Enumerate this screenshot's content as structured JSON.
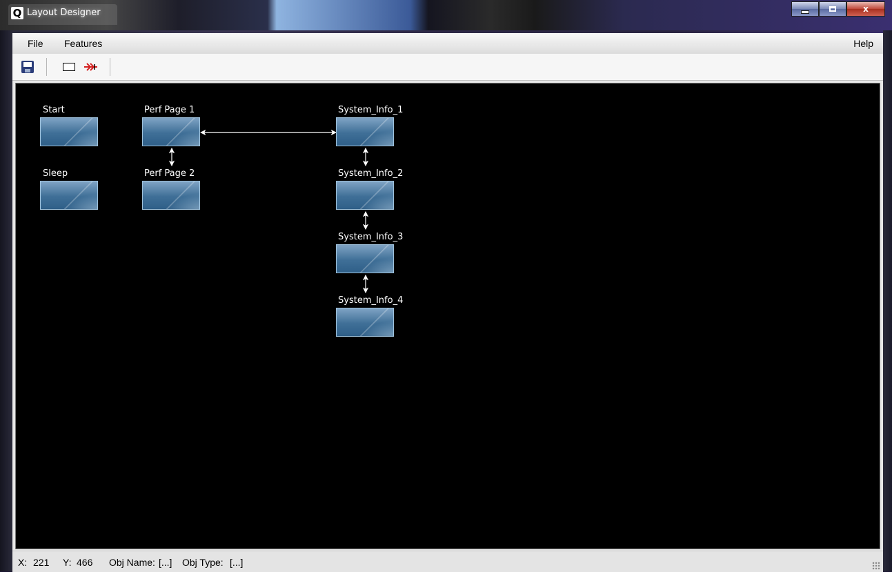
{
  "window": {
    "title": "Layout Designer",
    "app_icon_letter": "Q",
    "controls": [
      "minimize",
      "maximize",
      "close"
    ],
    "close_glyph": "x"
  },
  "menu": {
    "file": "File",
    "features": "Features",
    "help": "Help"
  },
  "toolbar": {
    "items": [
      "save-icon",
      "rectangle-icon",
      "connector-arrow-icon"
    ]
  },
  "canvas": {
    "background": "#000000",
    "nodes": [
      {
        "id": "start",
        "label": "Start"
      },
      {
        "id": "sleep",
        "label": "Sleep"
      },
      {
        "id": "perf1",
        "label": "Perf Page 1"
      },
      {
        "id": "perf2",
        "label": "Perf Page 2"
      },
      {
        "id": "sys1",
        "label": "System_Info_1"
      },
      {
        "id": "sys2",
        "label": "System_Info_2"
      },
      {
        "id": "sys3",
        "label": "System_Info_3"
      },
      {
        "id": "sys4",
        "label": "System_Info_4"
      }
    ],
    "links": [
      {
        "from": "perf1",
        "to": "sys1"
      },
      {
        "from": "perf1",
        "to": "perf2"
      },
      {
        "from": "sys1",
        "to": "sys2"
      },
      {
        "from": "sys2",
        "to": "sys3"
      },
      {
        "from": "sys3",
        "to": "sys4"
      }
    ]
  },
  "status": {
    "x_label": "X:",
    "x_value": "221",
    "y_label": "Y:",
    "y_value": "466",
    "obj_name_label": "Obj Name:",
    "obj_name_value": "[...]",
    "obj_type_label": "Obj Type:",
    "obj_type_value": "[...]"
  },
  "colors": {
    "accent_arrow": "#d42020",
    "node_fill": "#4a7aa4"
  }
}
